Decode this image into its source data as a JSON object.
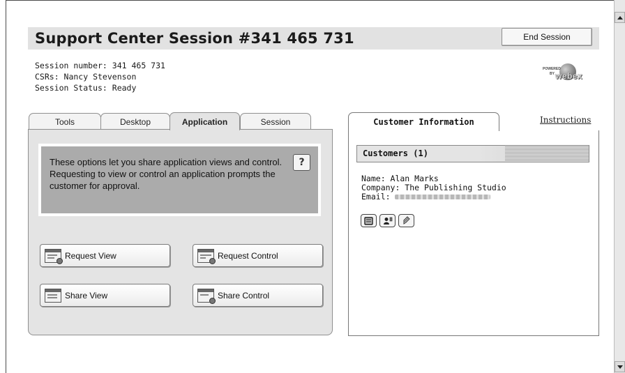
{
  "header": {
    "title": "Support Center Session #341 465 731",
    "end_session_label": "End Session"
  },
  "session_info": {
    "session_number": "Session number: 341 465 731",
    "csrs": "CSRs: Nancy Stevenson",
    "status": "Session Status: Ready"
  },
  "logo": {
    "powered": "POWERED",
    "by": "BY",
    "brand": "webex"
  },
  "tabs": [
    {
      "label": "Tools",
      "active": false
    },
    {
      "label": "Desktop",
      "active": false
    },
    {
      "label": "Application",
      "active": true
    },
    {
      "label": "Session",
      "active": false
    }
  ],
  "application": {
    "description": "These options let you share application views and control.  Requesting to view or control an application prompts the customer for approval.",
    "help_label": "?",
    "buttons": [
      {
        "label": "Request View",
        "icon": "request-view-icon"
      },
      {
        "label": "Request Control",
        "icon": "request-control-icon"
      },
      {
        "label": "Share View",
        "icon": "share-view-icon"
      },
      {
        "label": "Share Control",
        "icon": "share-control-icon"
      }
    ]
  },
  "customer_panel": {
    "tab_label": "Customer Information",
    "instructions_label": "Instructions",
    "customers_header": "Customers (1)",
    "name": "Name: Alan Marks",
    "company": "Company: The Publishing Studio",
    "email_label": "Email:",
    "action_icons": [
      "info-icon",
      "contact-icon",
      "edit-icon"
    ]
  }
}
